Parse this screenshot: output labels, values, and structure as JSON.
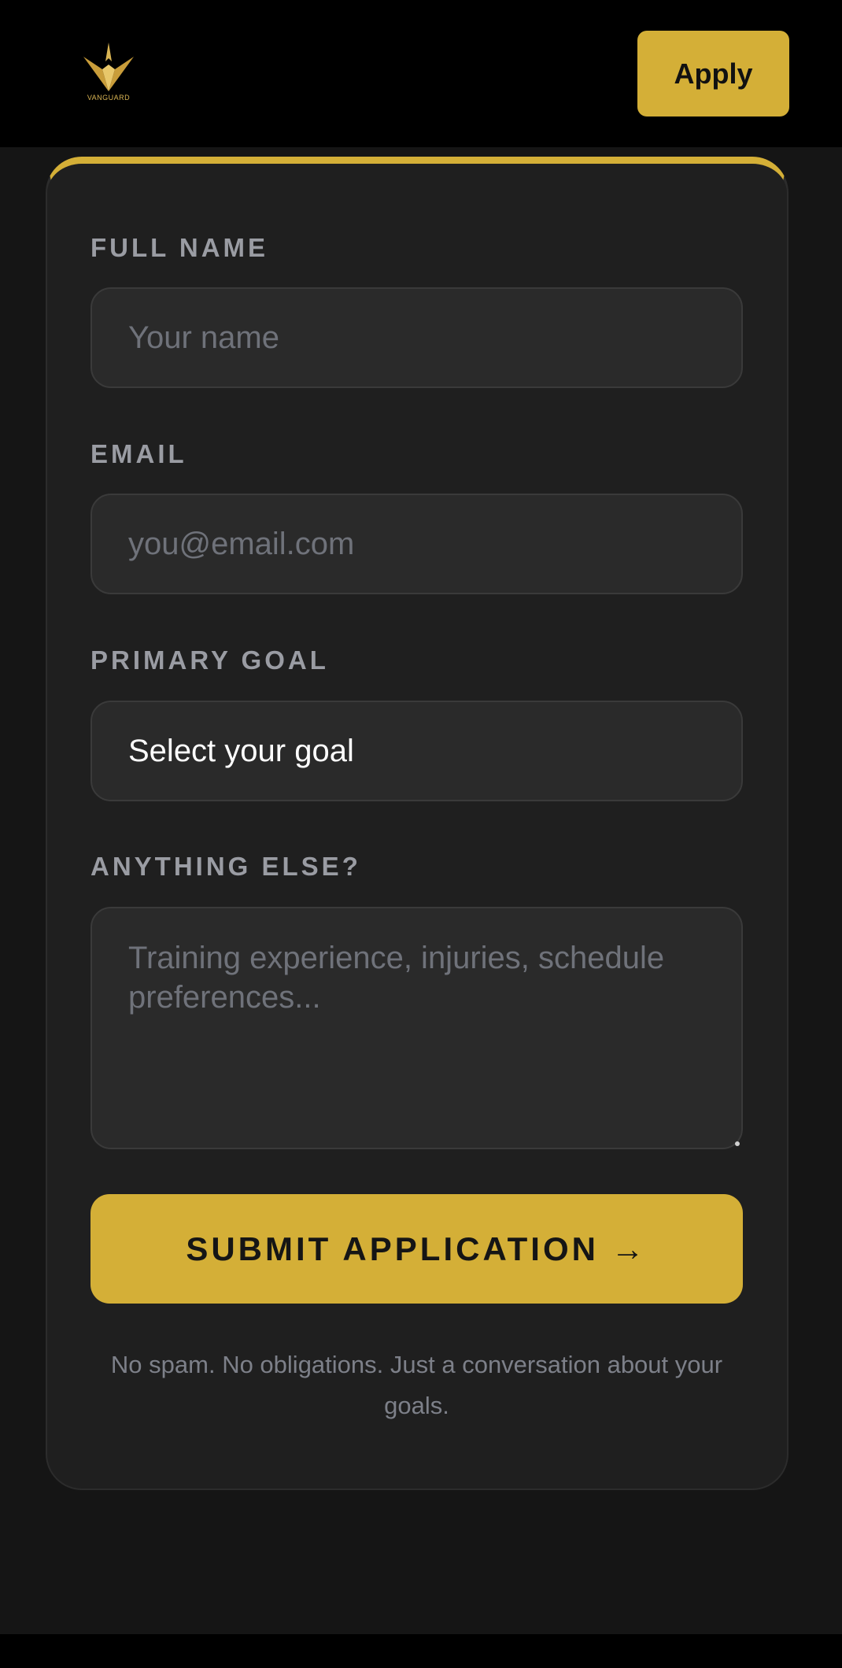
{
  "header": {
    "logo_text": "VANGUARD",
    "apply_label": "Apply"
  },
  "form": {
    "full_name": {
      "label": "FULL NAME",
      "placeholder": "Your name"
    },
    "email": {
      "label": "EMAIL",
      "placeholder": "you@email.com"
    },
    "primary_goal": {
      "label": "PRIMARY GOAL",
      "selected": "Select your goal"
    },
    "anything_else": {
      "label": "ANYTHING ELSE?",
      "placeholder": "Training experience, injuries, schedule preferences..."
    },
    "submit_label": "SUBMIT APPLICATION →",
    "note": "No spam. No obligations. Just a conversation about your goals."
  },
  "colors": {
    "accent": "#d4af37",
    "background": "#151515",
    "card": "#1f1f1f",
    "field": "#2a2a2a"
  }
}
